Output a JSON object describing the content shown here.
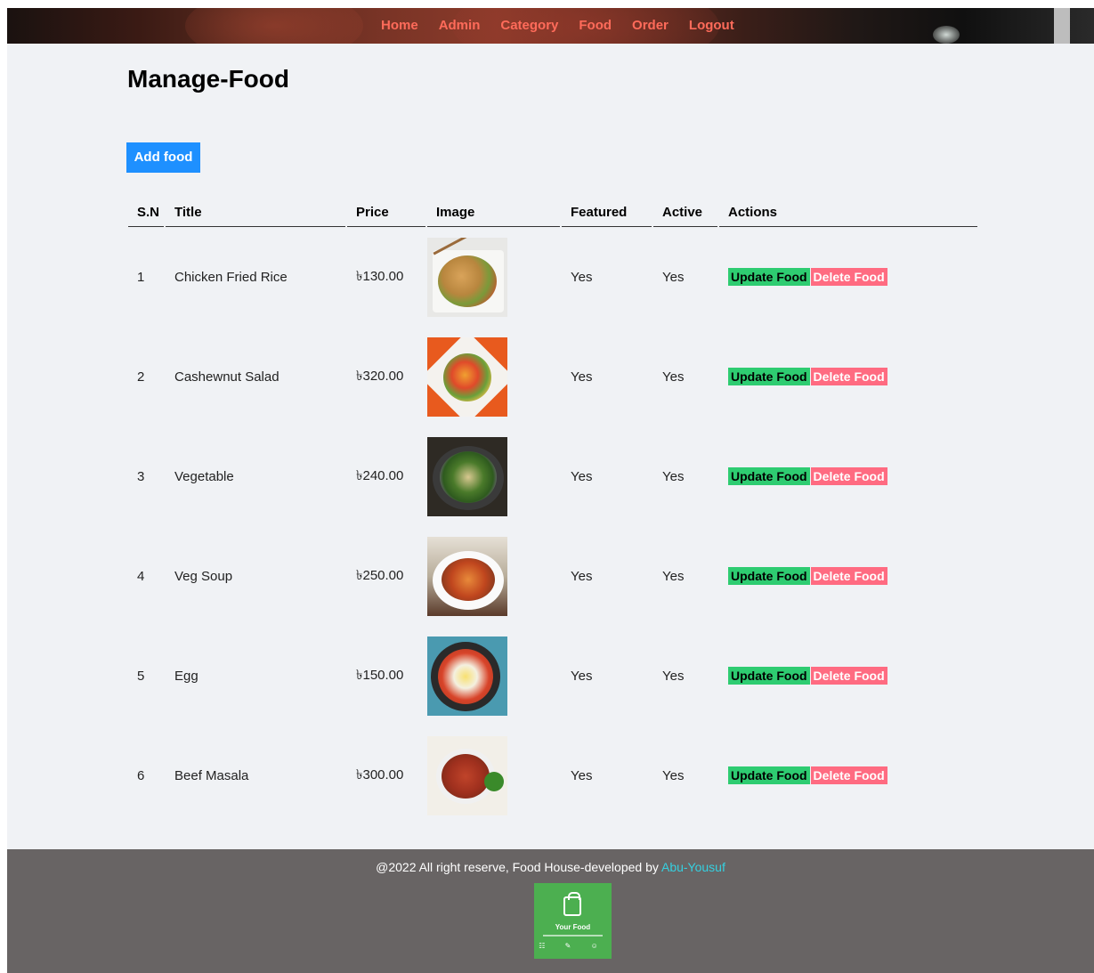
{
  "nav": {
    "items": [
      {
        "label": "Home"
      },
      {
        "label": "Admin"
      },
      {
        "label": "Category"
      },
      {
        "label": "Food"
      },
      {
        "label": "Order"
      },
      {
        "label": "Logout"
      }
    ]
  },
  "page": {
    "title": "Manage-Food",
    "add_button": "Add food"
  },
  "table": {
    "headers": [
      "S.N",
      "Title",
      "Price",
      "Image",
      "Featured",
      "Active",
      "Actions"
    ],
    "rows": [
      {
        "sn": "1",
        "title": "Chicken Fried Rice",
        "price": "৳130.00",
        "image": "fried-rice-image",
        "featured": "Yes",
        "active": "Yes",
        "update": "Update Food",
        "delete": "Delete Food"
      },
      {
        "sn": "2",
        "title": "Cashewnut Salad",
        "price": "৳320.00",
        "image": "salad-image",
        "featured": "Yes",
        "active": "Yes",
        "update": "Update Food",
        "delete": "Delete Food"
      },
      {
        "sn": "3",
        "title": "Vegetable",
        "price": "৳240.00",
        "image": "vegetable-image",
        "featured": "Yes",
        "active": "Yes",
        "update": "Update Food",
        "delete": "Delete Food"
      },
      {
        "sn": "4",
        "title": "Veg Soup",
        "price": "৳250.00",
        "image": "soup-image",
        "featured": "Yes",
        "active": "Yes",
        "update": "Update Food",
        "delete": "Delete Food"
      },
      {
        "sn": "5",
        "title": "Egg",
        "price": "৳150.00",
        "image": "egg-image",
        "featured": "Yes",
        "active": "Yes",
        "update": "Update Food",
        "delete": "Delete Food"
      },
      {
        "sn": "6",
        "title": "Beef Masala",
        "price": "৳300.00",
        "image": "beef-masala-image",
        "featured": "Yes",
        "active": "Yes",
        "update": "Update Food",
        "delete": "Delete Food"
      }
    ]
  },
  "footer": {
    "credit": "@2022 All right reserve, Food House-developed by ",
    "author": "Abu-Yousuf",
    "logo_text": "Your Food"
  },
  "colors": {
    "nav_link": "#ff6b5a",
    "add_button": "#1e90ff",
    "update_button": "#2ecc71",
    "delete_button": "#ff6b81",
    "footer_bg": "#686464",
    "author_link": "#35d0e0"
  }
}
